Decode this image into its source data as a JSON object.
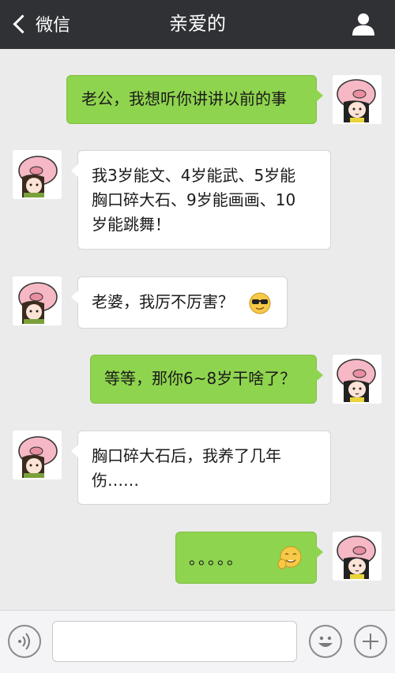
{
  "header": {
    "back_label": "微信",
    "title": "亲爱的"
  },
  "messages": [
    {
      "side": "right",
      "text": "老公，我想听你讲讲以前的事"
    },
    {
      "side": "left",
      "lines": [
        "我3岁能文、4岁能武、5岁能",
        "胸口碎大石、9岁能画画、10",
        "岁能跳舞！"
      ]
    },
    {
      "side": "left",
      "text": "老婆，我厉不厉害？",
      "emoji": "cool-sunglasses-emoji"
    },
    {
      "side": "right",
      "text": "等等，那你6~8岁干啥了？"
    },
    {
      "side": "left",
      "lines": [
        "胸口碎大石后，我养了几年",
        "伤……"
      ]
    },
    {
      "side": "right",
      "text": "。。。。。",
      "emoji": "awkward-smile-emoji"
    }
  ],
  "colors": {
    "header_bg": "#2f3135",
    "chat_bg": "#ebebeb",
    "right_bubble": "#8fd44e",
    "left_bubble": "#ffffff"
  }
}
